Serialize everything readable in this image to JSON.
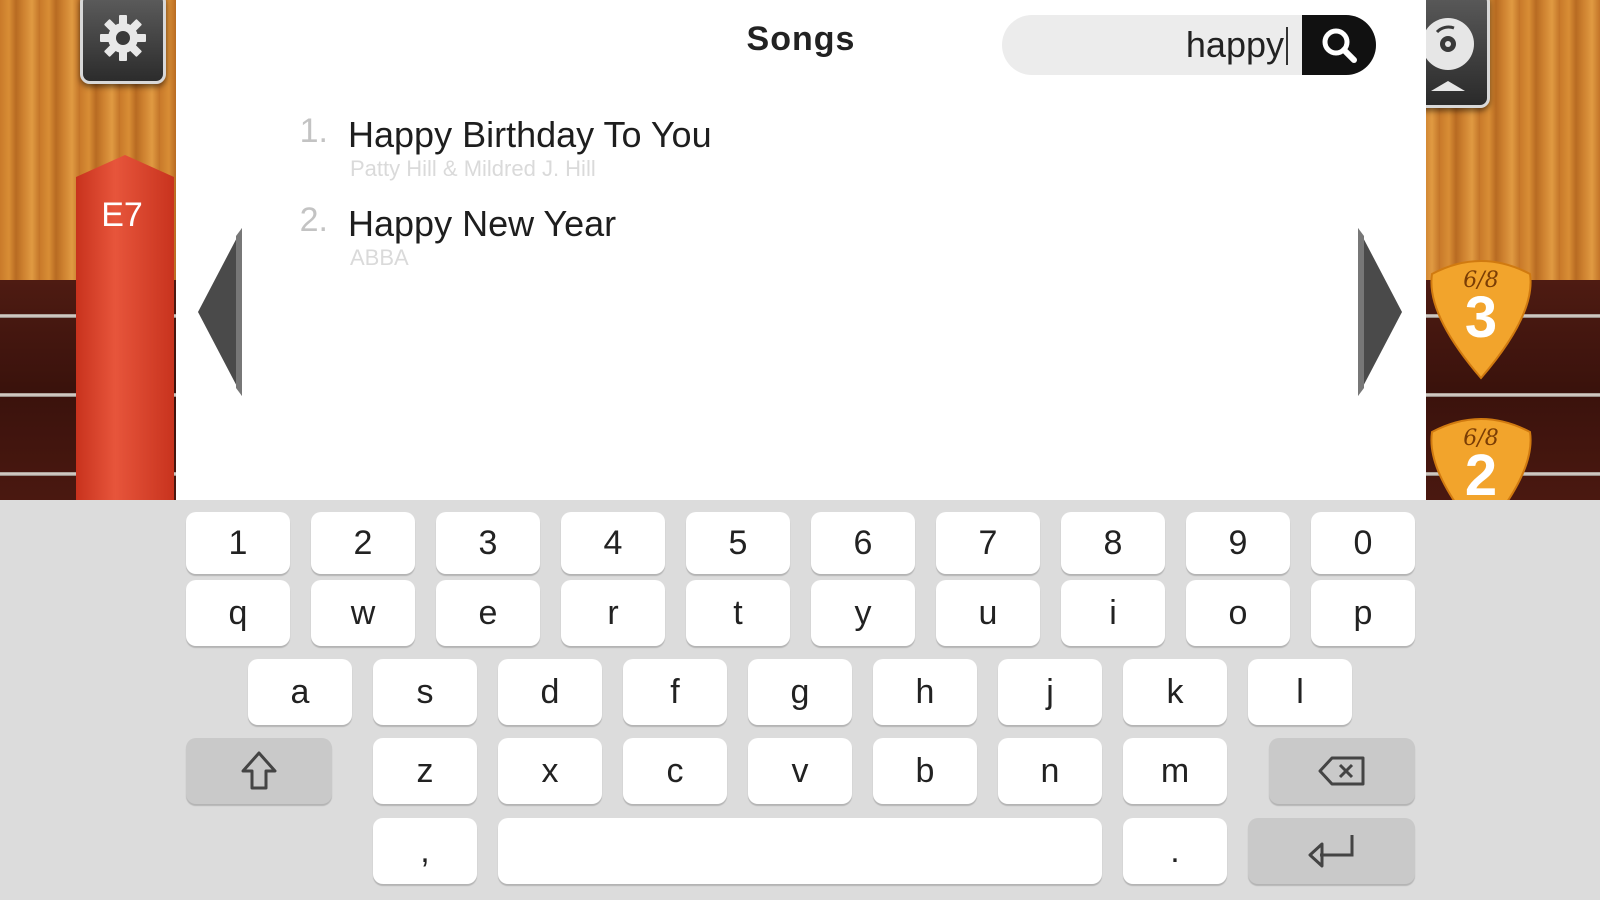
{
  "header": {
    "title": "Songs"
  },
  "search": {
    "value": "happy",
    "placeholder": ""
  },
  "chord": {
    "label": "E7"
  },
  "picks": [
    {
      "fraction": "6/8",
      "number": "3"
    },
    {
      "fraction": "6/8",
      "number": "2"
    }
  ],
  "songs": [
    {
      "number": "1.",
      "title": "Happy Birthday To You",
      "artist": "Patty Hill & Mildred J. Hill"
    },
    {
      "number": "2.",
      "title": "Happy New Year",
      "artist": "ABBA"
    }
  ],
  "icons": {
    "settings": "gear-icon",
    "search": "search-icon",
    "songbook": "disc-icon",
    "prev": "triangle-left-icon",
    "next": "triangle-right-icon",
    "shift": "shift-icon",
    "backspace": "backspace-icon",
    "enter": "enter-icon"
  },
  "keyboard": {
    "row_numbers": [
      "1",
      "2",
      "3",
      "4",
      "5",
      "6",
      "7",
      "8",
      "9",
      "0"
    ],
    "row_top": [
      "q",
      "w",
      "e",
      "r",
      "t",
      "y",
      "u",
      "i",
      "o",
      "p"
    ],
    "row_middle": [
      "a",
      "s",
      "d",
      "f",
      "g",
      "h",
      "j",
      "k",
      "l"
    ],
    "row_bottom": [
      "z",
      "x",
      "c",
      "v",
      "b",
      "n",
      "m"
    ],
    "comma": ",",
    "period": ".",
    "space": ""
  },
  "colors": {
    "panel": "#ffffff",
    "chord_bar": "#e04a31",
    "pick": "#f0a02a",
    "keyboard": "#dcdcdc"
  }
}
